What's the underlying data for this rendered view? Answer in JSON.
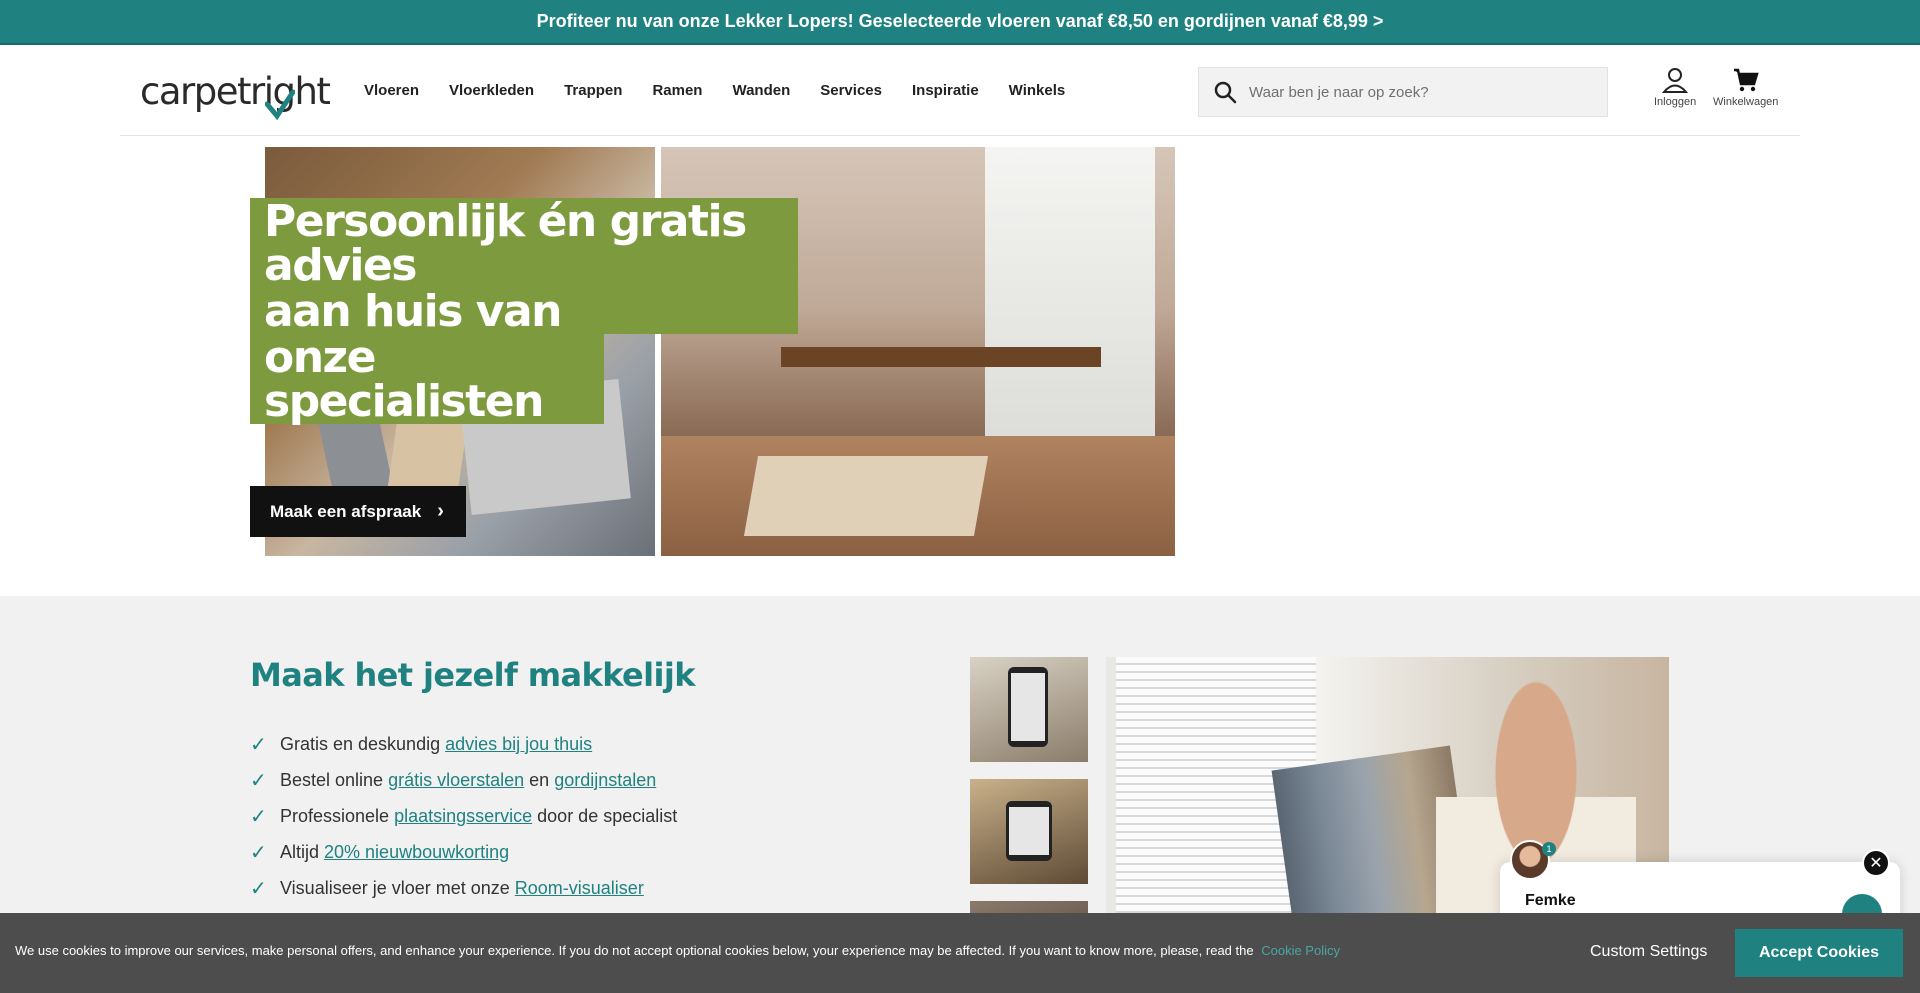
{
  "promo": {
    "text": "Profiteer nu van onze Lekker Lopers! Geselecteerde vloeren vanaf €8,50 en gordijnen vanaf €8,99 >"
  },
  "header": {
    "logo_text": "carpetright",
    "nav": [
      "Vloeren",
      "Vloerkleden",
      "Trappen",
      "Ramen",
      "Wanden",
      "Services",
      "Inspiratie",
      "Winkels"
    ],
    "search_placeholder": "Waar ben je naar op zoek?",
    "login_label": "Inloggen",
    "cart_label": "Winkelwagen"
  },
  "hero": {
    "title_line1": "Persoonlijk én gratis advies",
    "title_line2": "aan huis van",
    "title_line3": "onze specialisten",
    "button_label": "Maak een afspraak",
    "accent_color": "#7e9a3f"
  },
  "section2": {
    "title": "Maak het jezelf makkelijk",
    "items": [
      {
        "pre": "Gratis en deskundig",
        "link": "advies bij jou thuis",
        "mid": "",
        "link2": "",
        "post": ""
      },
      {
        "pre": "Bestel online",
        "link": "grátis vloerstalen",
        "mid": "en",
        "link2": "gordijnstalen",
        "post": ""
      },
      {
        "pre": "Professionele",
        "link": "plaatsingsservice",
        "mid": "",
        "link2": "",
        "post": "door de specialist"
      },
      {
        "pre": "Altijd",
        "link": "20% nieuwbouwkorting",
        "mid": "",
        "link2": "",
        "post": ""
      },
      {
        "pre": "Visualiseer je vloer met onze",
        "link": "Room-visualiser",
        "mid": "",
        "link2": "",
        "post": ""
      }
    ]
  },
  "chat": {
    "agent_name": "Femke",
    "badge_count": "1"
  },
  "cookie": {
    "text": "We use cookies to improve our services, make personal offers, and enhance your experience. If you do not accept optional cookies below, your experience may be affected. If you want to know more, please, read the",
    "link_text": "Cookie Policy",
    "custom_label": "Custom Settings",
    "accept_label": "Accept Cookies"
  },
  "colors": {
    "brand": "#1f8281",
    "cookie_bg": "#4d4d4d"
  }
}
